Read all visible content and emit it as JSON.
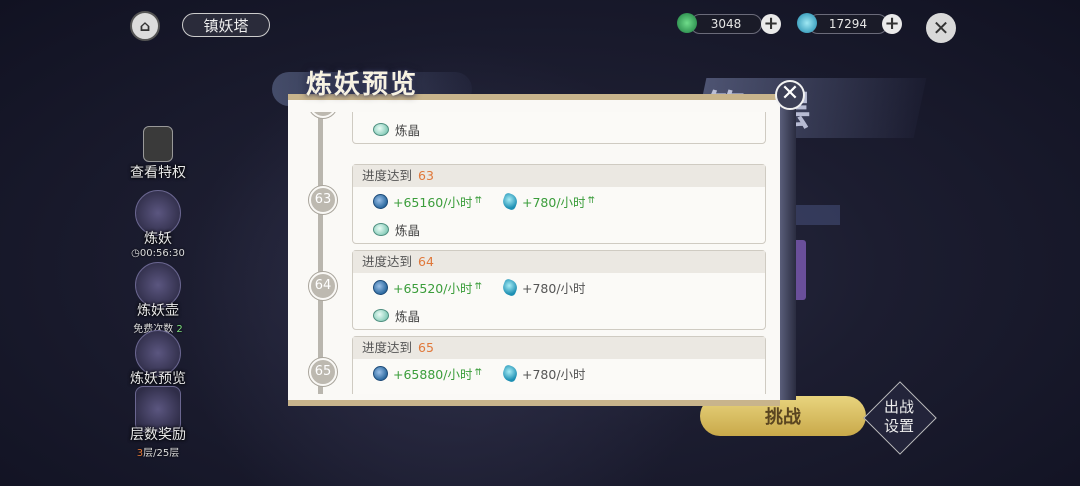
{
  "header": {
    "tower_name": "镇妖塔",
    "currency_1": "3048",
    "currency_2": "17294"
  },
  "background": {
    "floor_text": "第  层",
    "challenge_label": "挑战",
    "deploy_label_1": "出战",
    "deploy_label_2": "设置"
  },
  "sidebar": {
    "privilege_label": "查看特权",
    "refine_label": "炼妖",
    "refine_timer": "00:56:30",
    "pot_label": "炼妖壶",
    "pot_sub_prefix": "免费次数",
    "pot_sub_count": "2",
    "preview_label": "炼妖预览",
    "reward_label": "层数奖励",
    "reward_sub_current": "3",
    "reward_sub_rest": "层/25层"
  },
  "dialog": {
    "title": "炼妖预览",
    "progress_prefix": "进度达到",
    "crystal_label": "炼晶",
    "entries": [
      {
        "level": "63",
        "coin_gain": "+65160/小时",
        "gem_gain": "+780/小时"
      },
      {
        "level": "64",
        "coin_gain": "+65520/小时",
        "gem_gain": "+780/小时"
      },
      {
        "level": "65",
        "coin_gain": "+65880/小时",
        "gem_gain": "+780/小时"
      }
    ]
  }
}
